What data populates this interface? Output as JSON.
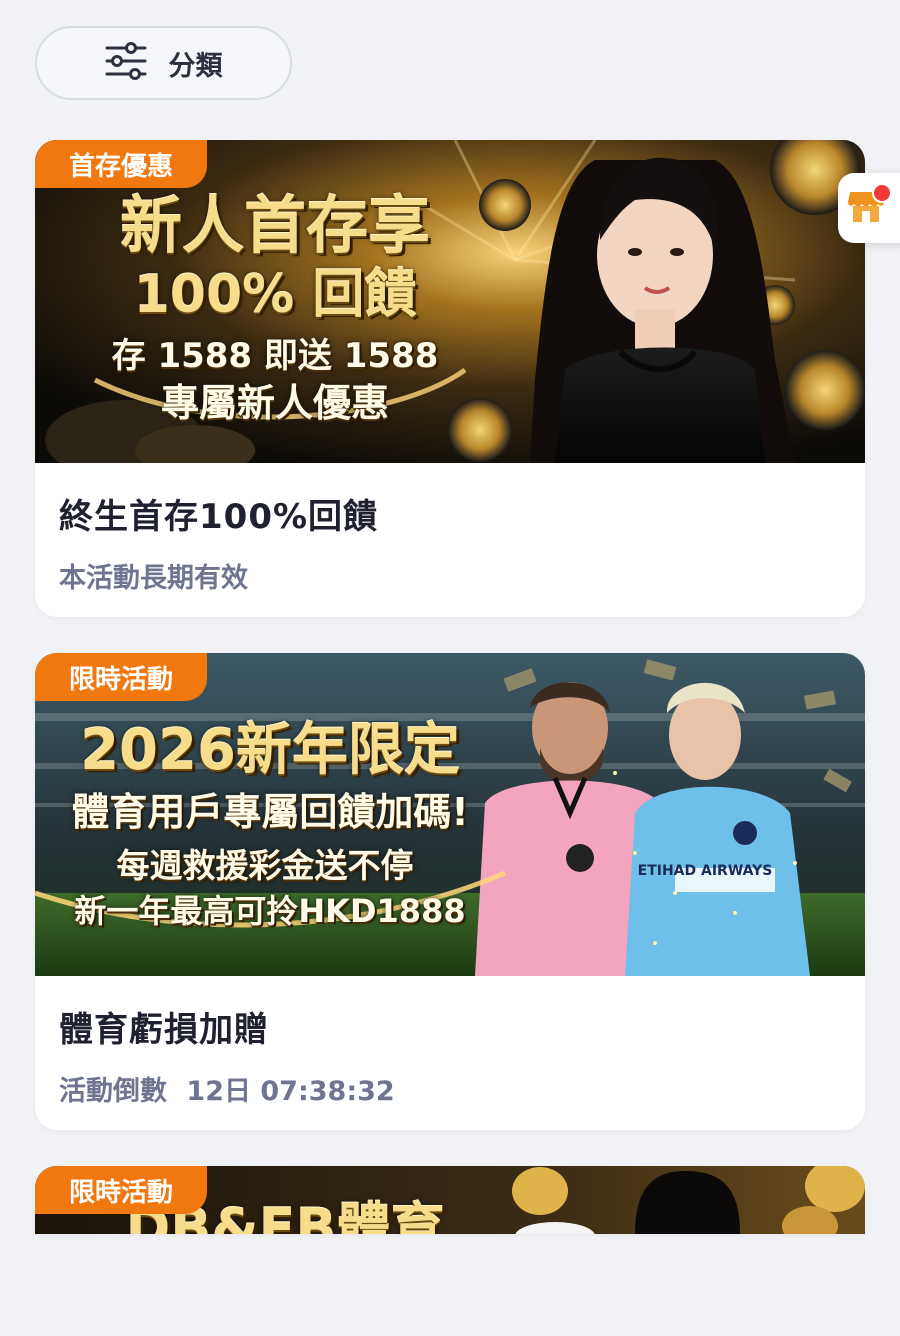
{
  "filter": {
    "label": "分類",
    "icon": "sliders-icon"
  },
  "floating": {
    "icon": "shop-icon"
  },
  "cards": [
    {
      "tag": "首存優惠",
      "banner": {
        "line1": "新人首存享",
        "line2": "100% 回饋",
        "line3": "存 1588 即送 1588",
        "line4": "專屬新人優惠"
      },
      "title": "終生首存100%回饋",
      "subtitle": "本活動長期有效"
    },
    {
      "tag": "限時活動",
      "banner": {
        "line1": "2026新年限定",
        "line2": "體育用戶專屬回饋加碼!",
        "line3": "每週救援彩金送不停",
        "line4": "新一年最高可拎HKD1888",
        "jersey_text": "ETIHAD AIRWAYS"
      },
      "title": "體育虧損加贈",
      "subtitle_prefix": "活動倒數",
      "countdown": "12日 07:38:32"
    },
    {
      "tag": "限時活動",
      "banner": {
        "line1": "DB&FB體育"
      }
    }
  ],
  "colors": {
    "tag_orange": "#f0780f",
    "page_bg": "#f1f2f6",
    "subtitle": "#6f7590",
    "badge_red": "#f23a3a"
  }
}
